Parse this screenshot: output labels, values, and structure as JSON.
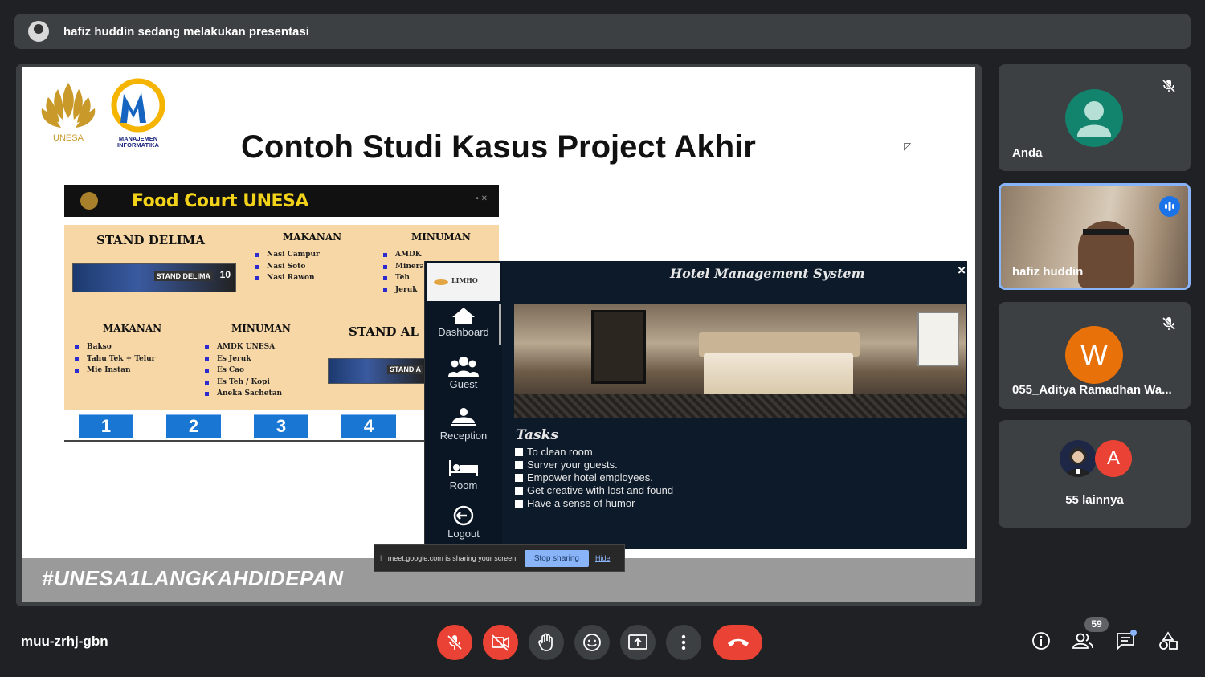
{
  "topbar": {
    "presenting_text": "hafiz huddin sedang melakukan presentasi"
  },
  "slide": {
    "title": "Contoh Studi Kasus Project Akhir",
    "logo_unesa_text": "UNESA",
    "logo_mi_text_1": "MANAJEMEN",
    "logo_mi_text_2": "INFORMATIKA",
    "hashtag": "#UNESA1LANGKAHDIDEPAN",
    "food_court": {
      "title": "Food Court UNESA",
      "stand_delima": "STAND DELIMA",
      "stand_al": "STAND AL",
      "stand_img_label": "STAND DELIMA",
      "stand_img_number": "10",
      "stand_img_label_2": "STAND A",
      "makanan": "MAKANAN",
      "minuman": "MINUMAN",
      "makanan_2": "MAKANAN",
      "minuman_2": "MINUMAN",
      "list_makanan_1": [
        "Nasi Campur",
        "Nasi Soto",
        "Nasi Rawon"
      ],
      "list_minuman_1": [
        "AMDK UNESA",
        "Mineral",
        "Teh",
        "Jeruk"
      ],
      "list_makanan_2": [
        "Bakso",
        "Tahu Tek + Telur",
        "Mie Instan"
      ],
      "list_minuman_2": [
        "AMDK UNESA",
        "Es Jeruk",
        "Es Cao",
        "Es Teh / Kopi",
        "Aneka Sachetan"
      ],
      "numbers": [
        "1",
        "2",
        "3",
        "4"
      ]
    },
    "hotel": {
      "brand": "LIMHO",
      "title": "Hotel Management System",
      "close": "×",
      "nav": [
        "Dashboard",
        "Guest",
        "Reception",
        "Room",
        "Logout"
      ],
      "tasks_title": "Tasks",
      "tasks": [
        "To clean room.",
        "Surver your guests.",
        "Empower hotel employees.",
        "Get creative with lost and found",
        "Have a sense of humor"
      ]
    },
    "share_bar": {
      "message": "meet.google.com is sharing your screen.",
      "stop_label": "Stop sharing",
      "hide_label": "Hide"
    }
  },
  "participants": [
    {
      "name": "Anda",
      "avatar_color": "#12836d",
      "muted": true
    },
    {
      "name": "hafiz huddin",
      "speaking": true
    },
    {
      "name": "055_Aditya Ramadhan Wa...",
      "initial": "W",
      "avatar_color": "#e8710a",
      "muted": true
    },
    {
      "more_label": "55 lainnya",
      "second_initial": "A",
      "second_color": "#ea4335"
    }
  ],
  "bottom": {
    "meeting_code": "muu-zrhj-gbn",
    "people_count": "59"
  },
  "colors": {
    "accent": "#8ab4f8",
    "danger": "#ea4335",
    "tile": "#3c4043",
    "bg": "#202124"
  }
}
